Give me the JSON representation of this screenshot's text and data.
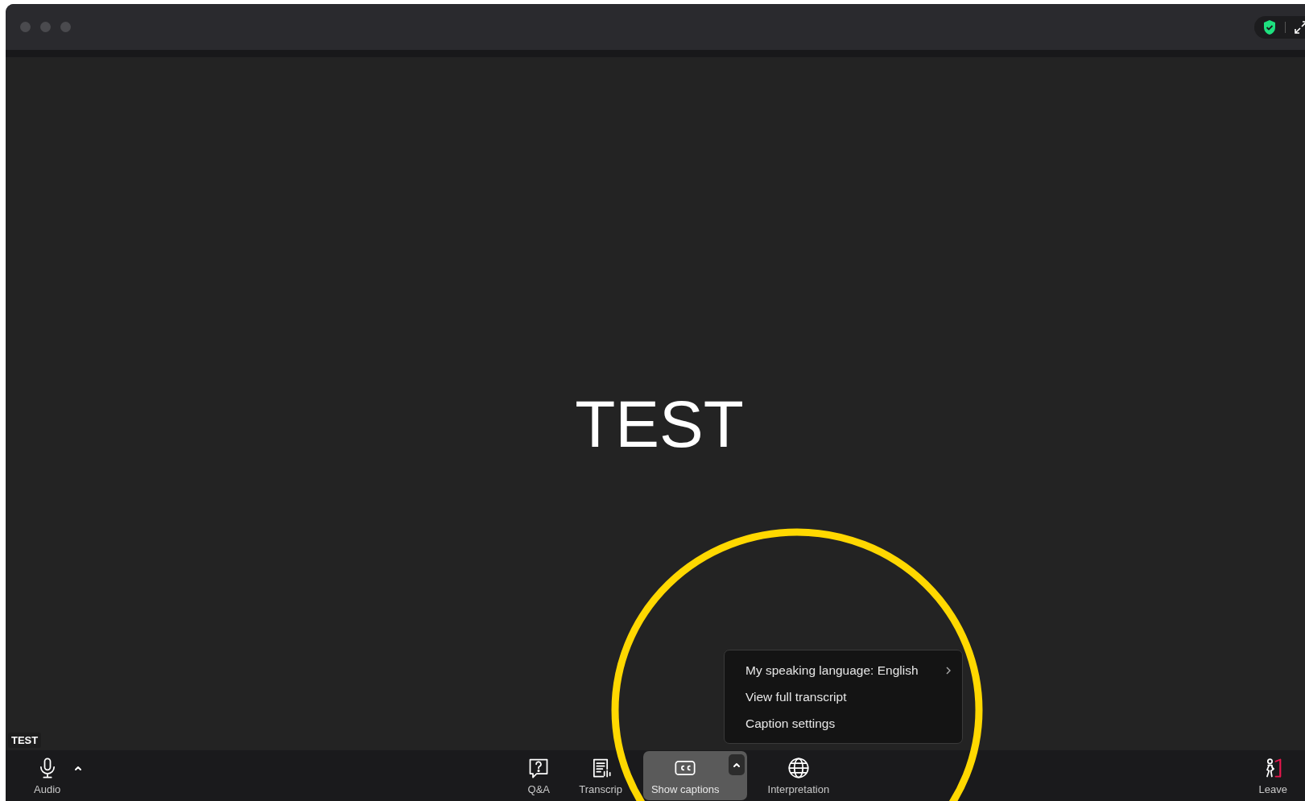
{
  "video": {
    "main_text": "TEST",
    "name_label": "TEST"
  },
  "caption_menu": {
    "items": [
      {
        "label": "My speaking language: English",
        "submenu": true
      },
      {
        "label": "View full transcript",
        "submenu": false
      },
      {
        "label": "Caption settings",
        "submenu": false
      }
    ]
  },
  "toolbar": {
    "left": [
      {
        "kind": "mic",
        "label": "Audio",
        "caret": true,
        "selected": false
      }
    ],
    "center": [
      {
        "kind": "qa",
        "label": "Q&A",
        "caret": false,
        "selected": false
      },
      {
        "kind": "transcript",
        "label": "Transcrip",
        "caret": false,
        "selected": false
      },
      {
        "kind": "cc",
        "label": "Show captions",
        "caret": true,
        "selected": true
      },
      {
        "kind": "globe",
        "label": "Interpretation",
        "caret": false,
        "selected": false
      }
    ],
    "right": [
      {
        "kind": "leave",
        "label": "Leave",
        "caret": false,
        "selected": false
      }
    ]
  }
}
